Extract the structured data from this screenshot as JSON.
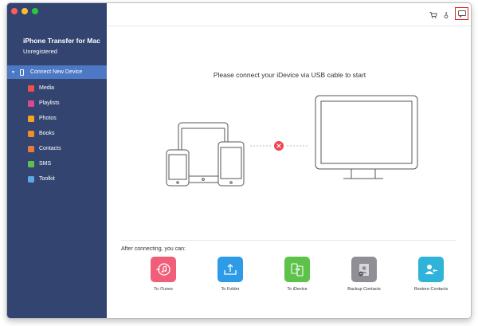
{
  "app": {
    "title": "iPhone Transfer for Mac",
    "status": "Unregistered"
  },
  "sidebar": {
    "device_label": "Connect New Device",
    "items": [
      {
        "label": "Media",
        "icon": "media-icon",
        "color": "#f0504a"
      },
      {
        "label": "Playlists",
        "icon": "playlists-icon",
        "color": "#d94a8c"
      },
      {
        "label": "Photos",
        "icon": "photos-icon",
        "color": "#f5a623"
      },
      {
        "label": "Books",
        "icon": "books-icon",
        "color": "#f58a2a"
      },
      {
        "label": "Contacts",
        "icon": "contacts-icon",
        "color": "#e87d3a"
      },
      {
        "label": "SMS",
        "icon": "sms-icon",
        "color": "#5ec14d"
      },
      {
        "label": "Toolkit",
        "icon": "toolkit-icon",
        "color": "#5aa8e8"
      }
    ]
  },
  "main": {
    "prompt": "Please connect your iDevice via USB cable to start",
    "after_label": "After connecting, you can:",
    "actions": [
      {
        "label": "To iTunes",
        "icon": "itunes-icon",
        "color": "#f05e7a"
      },
      {
        "label": "To Folder",
        "icon": "folder-export-icon",
        "color": "#2e9be6"
      },
      {
        "label": "To iDevice",
        "icon": "idevice-transfer-icon",
        "color": "#5cc24a"
      },
      {
        "label": "Backup Contacts",
        "icon": "backup-contacts-icon",
        "color": "#8f8f95"
      },
      {
        "label": "Restore Contacts",
        "icon": "restore-contacts-icon",
        "color": "#2fb3d8"
      }
    ]
  },
  "colors": {
    "sidebar_bg": "#334470",
    "selected_row": "#4c78c4",
    "disconnect_badge": "#f0424f",
    "feedback_highlight": "#e02424"
  }
}
